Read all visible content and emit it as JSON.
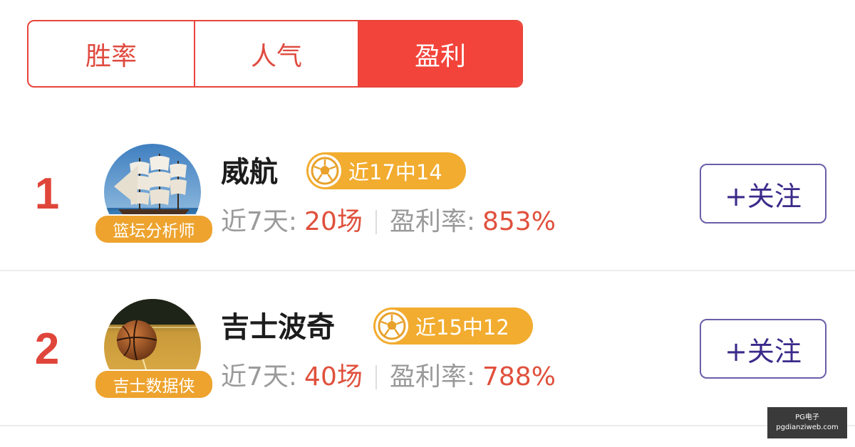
{
  "tabs": [
    {
      "label": "胜率",
      "active": false
    },
    {
      "label": "人气",
      "active": false
    },
    {
      "label": "盈利",
      "active": true
    }
  ],
  "colors": {
    "accent": "#f2443a",
    "rank": "#e0453a",
    "streak_badge": "#f2ac2f",
    "avatar_badge": "#eda32e",
    "follow_border": "#6b5ea8",
    "follow_text": "#3c2a8a",
    "stat_value": "#e0503c"
  },
  "experts": [
    {
      "rank": "1",
      "name": "威航",
      "avatar_badge": "篮坛分析师",
      "avatar_icon": "sailing-ship-image",
      "streak_icon": "soccer-ball-icon",
      "streak": "近17中14",
      "days_label": "近7天:",
      "days_value": "20场",
      "profit_label": "盈利率:",
      "profit_value": "853%",
      "follow_label": "+关注"
    },
    {
      "rank": "2",
      "name": "吉士波奇",
      "avatar_badge": "吉士数据侠",
      "avatar_icon": "basketball-court-image",
      "streak_icon": "soccer-ball-icon",
      "streak": "近15中12",
      "days_label": "近7天:",
      "days_value": "40场",
      "profit_label": "盈利率:",
      "profit_value": "788%",
      "follow_label": "+关注"
    }
  ],
  "watermark": {
    "line1": "PG电子",
    "line2": "pgdianziweb.com"
  }
}
